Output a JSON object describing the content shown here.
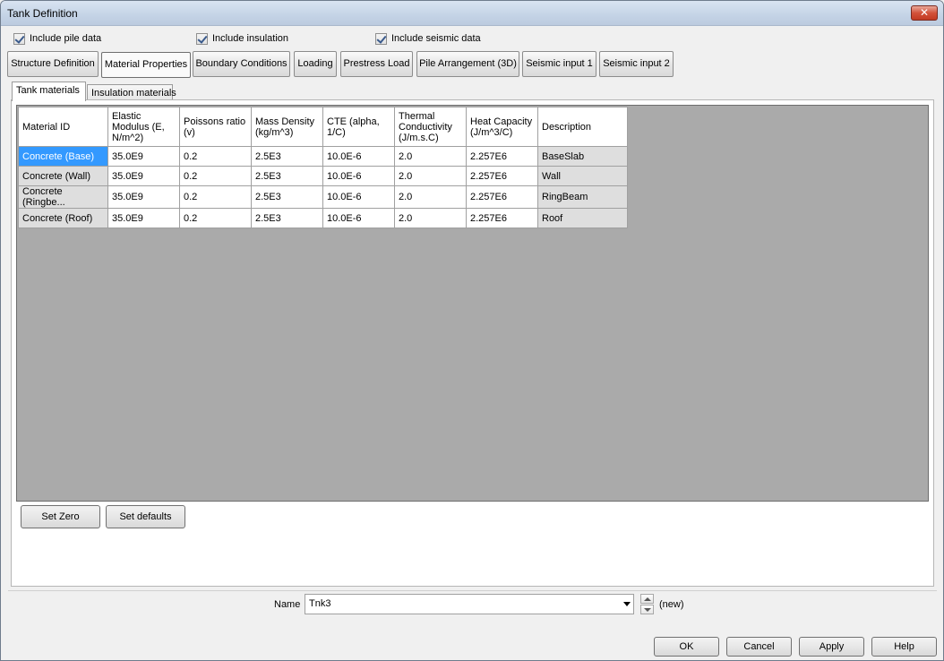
{
  "window": {
    "title": "Tank Definition",
    "close_label": "✕"
  },
  "options": {
    "pile": "Include pile data",
    "insulation": "Include insulation",
    "seismic": "Include seismic data"
  },
  "tabs": [
    "Structure Definition",
    "Material Properties",
    "Boundary Conditions",
    "Loading",
    "Prestress Load",
    "Pile Arrangement (3D)",
    "Seismic input 1",
    "Seismic input 2"
  ],
  "active_tab": "Material Properties",
  "subtabs": [
    "Tank materials",
    "Insulation materials"
  ],
  "active_subtab": "Tank materials",
  "table": {
    "headers": [
      "Material ID",
      "Elastic Modulus  (E, N/m^2)",
      "Poissons ratio (v)",
      "Mass Density (kg/m^3)",
      "CTE (alpha, 1/C)",
      "Thermal Conductivity (J/m.s.C)",
      "Heat Capacity (J/m^3/C)",
      "Description"
    ],
    "rows": [
      [
        "Concrete (Base)",
        "35.0E9",
        "0.2",
        "2.5E3",
        "10.0E-6",
        "2.0",
        "2.257E6",
        "BaseSlab"
      ],
      [
        "Concrete (Wall)",
        "35.0E9",
        "0.2",
        "2.5E3",
        "10.0E-6",
        "2.0",
        "2.257E6",
        "Wall"
      ],
      [
        "Concrete (Ringbe...",
        "35.0E9",
        "0.2",
        "2.5E3",
        "10.0E-6",
        "2.0",
        "2.257E6",
        "RingBeam"
      ],
      [
        "Concrete (Roof)",
        "35.0E9",
        "0.2",
        "2.5E3",
        "10.0E-6",
        "2.0",
        "2.257E6",
        "Roof"
      ]
    ]
  },
  "actions": {
    "set_zero": "Set Zero",
    "set_defaults": "Set defaults"
  },
  "name_field": {
    "label": "Name",
    "value": "Tnk3",
    "status": "(new)"
  },
  "footer": {
    "ok": "OK",
    "cancel": "Cancel",
    "apply": "Apply",
    "help": "Help"
  },
  "colors": {
    "selection": "#3399ff",
    "titlebar": "#c4d3e6",
    "close": "#c23a22"
  }
}
